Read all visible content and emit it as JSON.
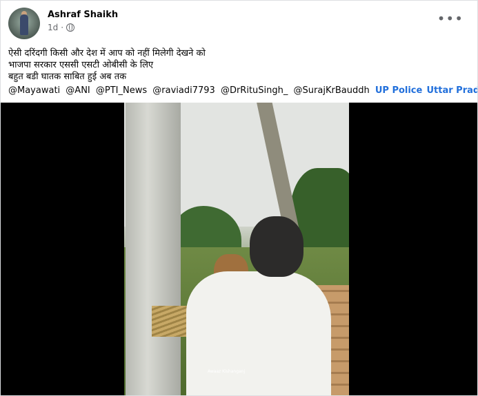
{
  "post": {
    "author": "Ashraf Shaikh",
    "time": "1d",
    "separator": "·",
    "privacy_icon": "globe-icon",
    "more_icon": "more-horizontal-icon",
    "more_label": "•••",
    "lines": [
      "ऐसी दरिंदगी किसी और देश में आप को नहीं मिलेगी देखने को",
      "भाजपा सरकार एससी एसटी ओबीसी के लिए",
      "बहुत बडी घातक साबित हुई अब तक"
    ],
    "mentions": [
      "@Mayawati",
      "@ANI",
      "@PTI_News",
      "@raviadi7793",
      "@DrRituSingh_",
      "@SurajKrBauddh"
    ],
    "links": [
      "UP Police",
      "Uttar Pradesh Police"
    ]
  },
  "video": {
    "watermark": "Awaaz Kishanganj"
  },
  "colors": {
    "link": "#216fdb",
    "secondary_text": "#65676b",
    "primary_text": "#050505"
  }
}
